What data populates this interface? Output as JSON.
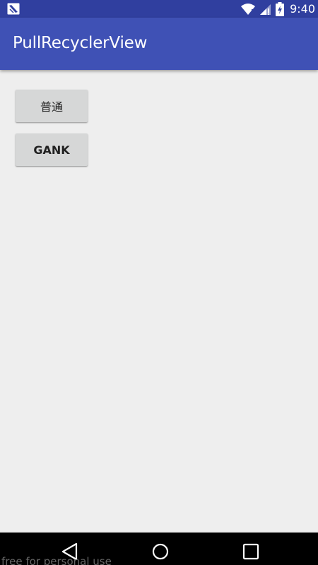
{
  "status_bar": {
    "time": "9:40",
    "icons": [
      "notification-icon",
      "wifi-icon",
      "cell-signal-icon",
      "battery-icon"
    ],
    "color": "#303f9f"
  },
  "app_bar": {
    "title": "PullRecyclerView",
    "color": "#3f51b5"
  },
  "content": {
    "buttons": [
      {
        "label": "普通"
      },
      {
        "label": "GANK"
      }
    ]
  },
  "nav_bar": {
    "buttons": [
      "back-icon",
      "home-icon",
      "recents-icon"
    ]
  },
  "watermark": "free for personal use"
}
